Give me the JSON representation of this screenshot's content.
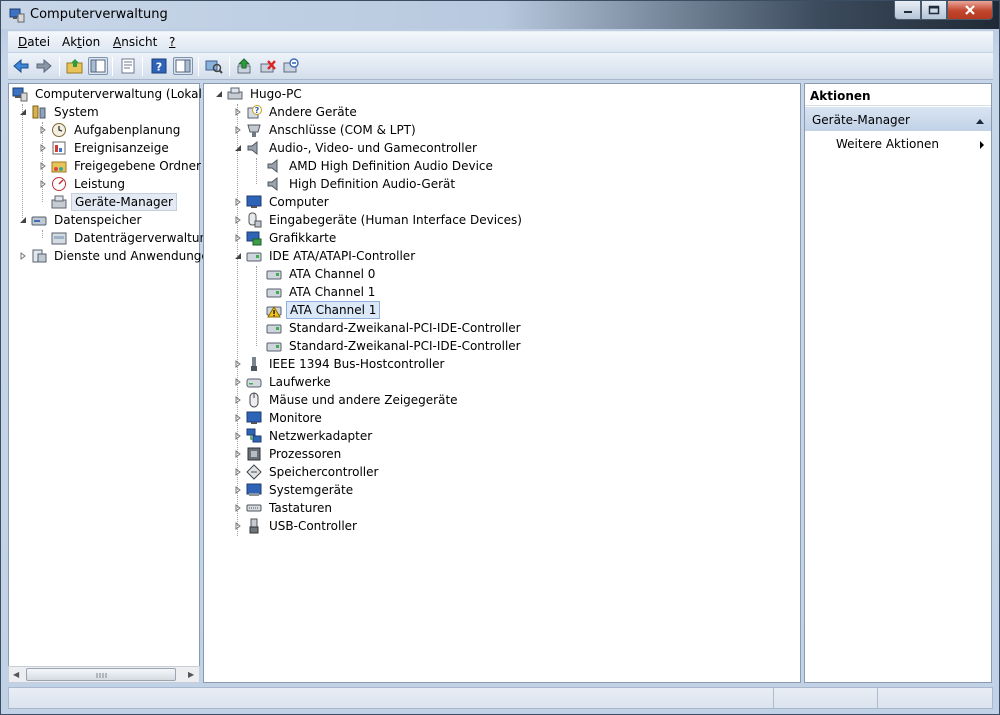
{
  "window": {
    "title": "Computerverwaltung"
  },
  "menu": [
    {
      "label": "Datei",
      "key": "D",
      "rest": "atei"
    },
    {
      "label": "Aktion",
      "pre": "Ak",
      "key": "t",
      "rest": "ion"
    },
    {
      "label": "Ansicht",
      "key": "A",
      "rest": "nsicht"
    },
    {
      "label": "?",
      "key": "?",
      "rest": ""
    }
  ],
  "left_tree": [
    {
      "label": "Computerverwaltung (Lokal)",
      "icon": "computer-management-icon"
    },
    {
      "label": "System",
      "icon": "system-tools-icon"
    },
    {
      "label": "Aufgabenplanung",
      "icon": "clock-icon"
    },
    {
      "label": "Ereignisanzeige",
      "icon": "event-viewer-icon"
    },
    {
      "label": "Freigegebene Ordner",
      "icon": "shared-folder-icon"
    },
    {
      "label": "Leistung",
      "icon": "performance-icon"
    },
    {
      "label": "Geräte-Manager",
      "icon": "device-manager-icon"
    },
    {
      "label": "Datenspeicher",
      "icon": "storage-icon"
    },
    {
      "label": "Datenträgerverwaltung",
      "icon": "disk-icon"
    },
    {
      "label": "Dienste und Anwendungen",
      "icon": "services-icon"
    }
  ],
  "device_tree": [
    {
      "label": "Hugo-PC",
      "icon": "computer-icon"
    },
    {
      "label": "Andere Geräte",
      "icon": "unknown-device-icon"
    },
    {
      "label": "Anschlüsse (COM & LPT)",
      "icon": "port-icon"
    },
    {
      "label": "Audio-, Video- und Gamecontroller",
      "icon": "speaker-icon"
    },
    {
      "label": "AMD High Definition Audio Device",
      "icon": "speaker-icon"
    },
    {
      "label": "High Definition Audio-Gerät",
      "icon": "speaker-icon"
    },
    {
      "label": "Computer",
      "icon": "monitor-icon"
    },
    {
      "label": "Eingabegeräte (Human Interface Devices)",
      "icon": "hid-icon"
    },
    {
      "label": "Grafikkarte",
      "icon": "display-adapter-icon"
    },
    {
      "label": "IDE ATA/ATAPI-Controller",
      "icon": "ide-controller-icon"
    },
    {
      "label": "ATA Channel 0",
      "icon": "ide-controller-icon"
    },
    {
      "label": "ATA Channel 1",
      "icon": "ide-controller-icon"
    },
    {
      "label": "ATA Channel 1",
      "icon": "warning-icon"
    },
    {
      "label": "Standard-Zweikanal-PCI-IDE-Controller",
      "icon": "ide-controller-icon"
    },
    {
      "label": "Standard-Zweikanal-PCI-IDE-Controller",
      "icon": "ide-controller-icon"
    },
    {
      "label": "IEEE 1394 Bus-Hostcontroller",
      "icon": "firewire-icon"
    },
    {
      "label": "Laufwerke",
      "icon": "drive-icon"
    },
    {
      "label": "Mäuse und andere Zeigegeräte",
      "icon": "mouse-icon"
    },
    {
      "label": "Monitore",
      "icon": "monitor-icon"
    },
    {
      "label": "Netzwerkadapter",
      "icon": "network-icon"
    },
    {
      "label": "Prozessoren",
      "icon": "processor-icon"
    },
    {
      "label": "Speichercontroller",
      "icon": "storage-controller-icon"
    },
    {
      "label": "Systemgeräte",
      "icon": "system-device-icon"
    },
    {
      "label": "Tastaturen",
      "icon": "keyboard-icon"
    },
    {
      "label": "USB-Controller",
      "icon": "usb-icon"
    }
  ],
  "actions": {
    "header": "Aktionen",
    "section": "Geräte-Manager",
    "item": "Weitere Aktionen"
  },
  "colors": {
    "accent": "#c1d2e7",
    "close": "#c2452d"
  }
}
